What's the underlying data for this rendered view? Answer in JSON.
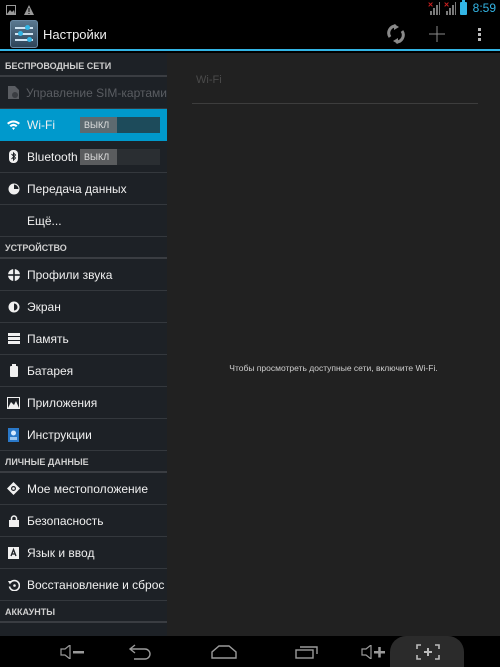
{
  "status_bar": {
    "left_icons": [
      "image-icon",
      "warning-icon"
    ],
    "right_icons": [
      "signal-no-sim-icon",
      "signal-no-sim-icon",
      "battery-icon"
    ],
    "time": "8:59"
  },
  "action_bar": {
    "title": "Настройки",
    "app_icon": "settings-sliders-icon",
    "actions": [
      {
        "name": "sync-icon",
        "glyph": "⟳"
      },
      {
        "name": "add-icon",
        "glyph": "+"
      },
      {
        "name": "overflow-menu-icon",
        "glyph": "⋮"
      }
    ]
  },
  "sidebar": {
    "sections": [
      {
        "header": "БЕСПРОВОДНЫЕ СЕТИ",
        "items": [
          {
            "label": "Управление SIM-картами",
            "icon": "sim-card-icon",
            "disabled": true
          },
          {
            "label": "Wi-Fi",
            "icon": "wifi-icon",
            "active": true,
            "toggle": "ВЫКЛ"
          },
          {
            "label": "Bluetooth",
            "icon": "bluetooth-icon",
            "toggle": "ВЫКЛ"
          },
          {
            "label": "Передача данных",
            "icon": "data-usage-icon"
          },
          {
            "label": "Ещё...",
            "icon": ""
          }
        ]
      },
      {
        "header": "УСТРОЙСТВО",
        "items": [
          {
            "label": "Профили звука",
            "icon": "sound-profile-icon"
          },
          {
            "label": "Экран",
            "icon": "display-icon"
          },
          {
            "label": "Память",
            "icon": "storage-icon"
          },
          {
            "label": "Батарея",
            "icon": "battery-icon"
          },
          {
            "label": "Приложения",
            "icon": "apps-icon"
          },
          {
            "label": "Инструкции",
            "icon": "instructions-icon"
          }
        ]
      },
      {
        "header": "ЛИЧНЫЕ ДАННЫЕ",
        "items": [
          {
            "label": "Мое местоположение",
            "icon": "location-icon"
          },
          {
            "label": "Безопасность",
            "icon": "lock-icon"
          },
          {
            "label": "Язык и ввод",
            "icon": "language-icon"
          },
          {
            "label": "Восстановление и сброс",
            "icon": "backup-restore-icon"
          }
        ]
      },
      {
        "header": "АККАУНТЫ",
        "items": []
      }
    ]
  },
  "content": {
    "title": "Wi-Fi",
    "empty_message": "Чтобы просмотреть доступные сети, включите Wi-Fi."
  },
  "nav_bar": {
    "buttons": [
      "volume-down-icon",
      "back-icon",
      "home-icon",
      "recent-apps-icon",
      "volume-up-icon",
      "screenshot-icon"
    ]
  },
  "colors": {
    "accent": "#33b5e5",
    "active_item": "#0099cc",
    "sidebar_bg": "#1d2126",
    "content_bg": "#212121"
  }
}
